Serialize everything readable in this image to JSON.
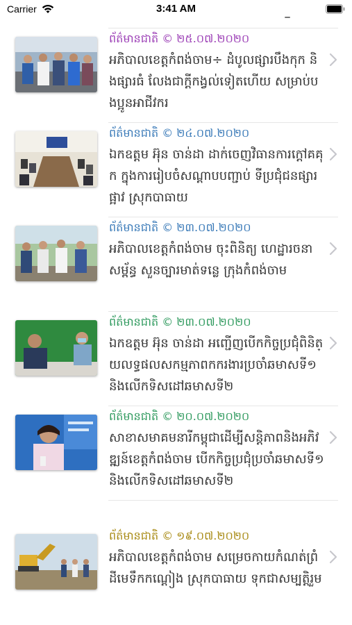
{
  "status_bar": {
    "carrier": "Carrier",
    "time": "3:41 AM"
  },
  "news": {
    "items": [
      {
        "category": "ព័ត៌មានជាតិ",
        "date": "© ២៥.០៧.២០២០",
        "meta_color": "#9c3fb6",
        "title": "អភិបាលខេត្តកំពង់ចាម÷ ដំបូលផ្សារបឹងកុក និងផ្សារធំ លែងជាក្ដីកង្វល់ទៀតហើយ សម្រាប់បងប្អូនអាជីវករ",
        "image": "officials-at-market-icon"
      },
      {
        "category": "ព័ត៌មានជាតិ",
        "date": "© ២៤.០៧.២០២០",
        "meta_color": "#3a7ab8",
        "title": "ឯកឧត្តម អ៊ុន ចាន់ដា ដាក់ចេញវិធានការក្ដៅគគុក ក្នុងការរៀបចំសណ្ដាបបញ្ជាប់ ទីប្រជុំជនផ្សារផ្អាវ ស្រុកបាធាយ",
        "image": "meeting-room-icon"
      },
      {
        "category": "ព័ត៌មានជាតិ",
        "date": "© ២៣.០៧.២០២០",
        "meta_color": "#3a7ab8",
        "title": "អភិបាលខេត្តកំពង់ចាម ចុះពិនិត្យ ហេដ្ឋារចនាសម្ព័ន្ធ សួនច្បារមាត់ទន្លេ ក្រុងកំពង់ចាម",
        "image": "site-inspection-icon"
      },
      {
        "category": "ព័ត៌មានជាតិ",
        "date": "© ២៣.០៧.២០២០",
        "meta_color": "#2f9a5e",
        "title": "ឯកឧត្តម អ៊ុន ចាន់ដា អញ្ជើញបើកកិច្ចប្រជុំពិនិត្យលទ្ធផលសកម្មភាពកករងារប្រចាំឆមាសទី១ និងលើកទិសដៅឆមាសទី២",
        "image": "conference-speaker-icon"
      },
      {
        "category": "ព័ត៌មានជាតិ",
        "date": "© ២០.០៧.២០២០",
        "meta_color": "#2f9a5e",
        "title": "សាខាសមាគមនារីកម្ពុជាដើម្បីសន្តិភាពនិងអភិវឌ្ឍន៍ខេត្តកំពង់ចាម បើកកិច្ចប្រជុំប្រចាំឆមាសទី១ និងលើកទិសដៅឆមាសទី២",
        "image": "woman-speaker-icon"
      },
      {
        "category": "ព័ត៌មានជាតិ",
        "date": "© ១៩.០៧.២០២០",
        "meta_color": "#a88a14",
        "title": "អភិបាលខេត្តកំពង់ចាម សម្រេចកាយកំណត់ព្រំដីមេទឹកកណ្ដៀង ស្រុកបាធាយ ទុកជាសម្បត្តិរួម",
        "image": "excavator-site-icon"
      }
    ]
  }
}
